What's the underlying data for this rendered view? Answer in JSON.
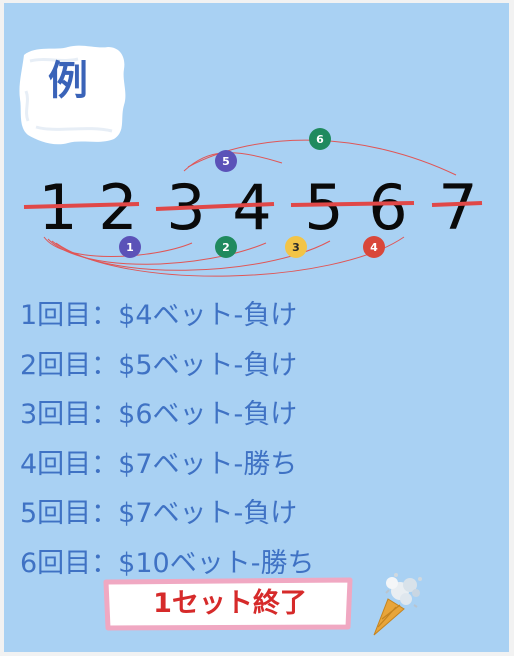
{
  "badge": {
    "label": "例"
  },
  "sequence": [
    "1",
    "2",
    "3",
    "4",
    "5",
    "6",
    "7"
  ],
  "markers": [
    {
      "label": "1",
      "color": "#5b52b8"
    },
    {
      "label": "2",
      "color": "#1f8a5e"
    },
    {
      "label": "3",
      "color": "#f2c447"
    },
    {
      "label": "4",
      "color": "#d9473a"
    },
    {
      "label": "5",
      "color": "#5b52b8"
    },
    {
      "label": "6",
      "color": "#1f8a5e"
    }
  ],
  "rounds": [
    {
      "text": "1回目：$4ベット-負け"
    },
    {
      "text": "2回目：$5ベット-負け"
    },
    {
      "text": "3回目：$6ベット-負け"
    },
    {
      "text": "4回目：$7ベット-勝ち"
    },
    {
      "text": "5回目：$7ベット-負け"
    },
    {
      "text": "6回目：$10ベット-勝ち"
    }
  ],
  "footer": {
    "label": "1セット終了"
  },
  "colors": {
    "background": "#a9d1f3",
    "text_blue": "#3f72c4",
    "strike_red": "#e04848",
    "footer_red": "#d62a2a",
    "footer_border": "#f0a8c2"
  },
  "icons": {
    "celebration": "party-popper-icon"
  }
}
